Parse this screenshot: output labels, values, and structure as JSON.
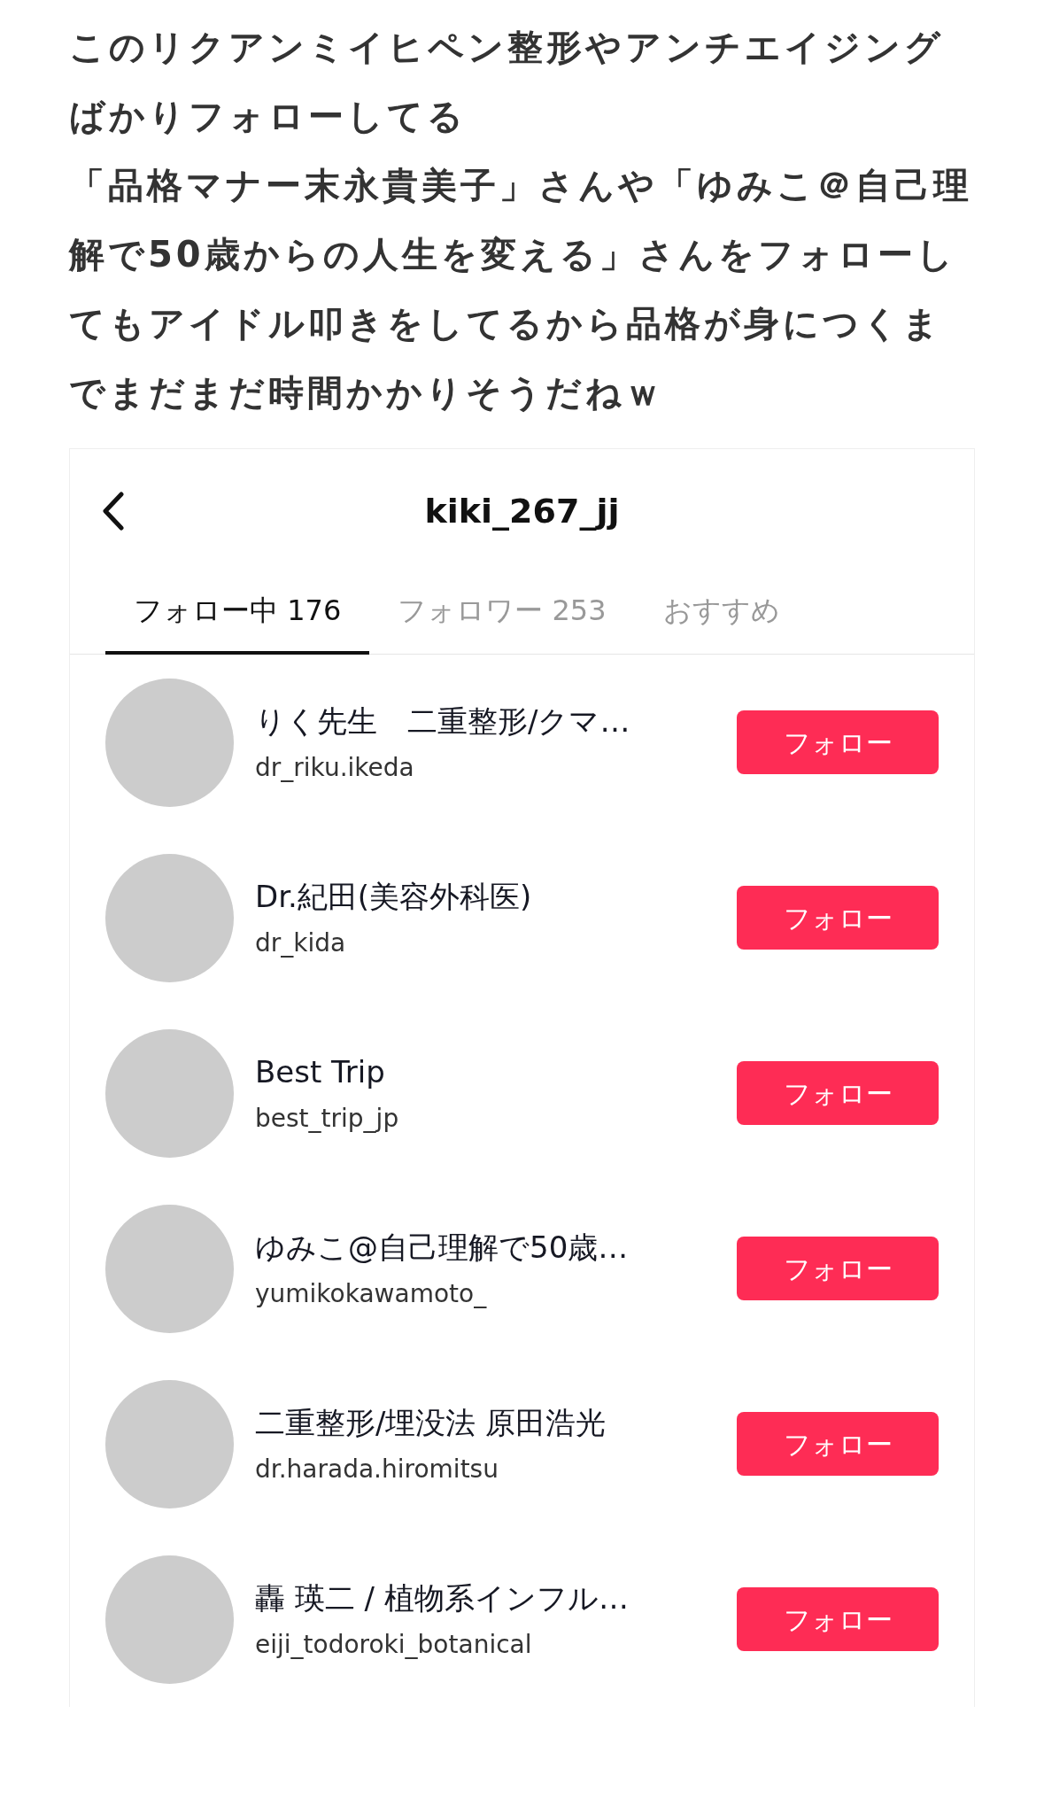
{
  "post_paragraphs": [
    "このリクアンミイヒペン整形やアンチエイジングばかりフォローしてる",
    "「品格マナー末永貴美子」さんや「ゆみこ＠自己理解で50歳からの人生を変える」さんをフォローしてもアイドル叩きをしてるから品格が身につくまでまだまだ時間かかりそうだねｗ"
  ],
  "screenshot": {
    "title": "kiki_267_jj",
    "tabs": [
      {
        "label": "フォロー中 176",
        "selected": true
      },
      {
        "label": "フォロワー 253",
        "selected": false
      },
      {
        "label": "おすすめ",
        "selected": false
      }
    ],
    "users": [
      {
        "name": "りく先生　二重整形/クマ…",
        "username": "dr_riku.ikeda",
        "button": "フォロー"
      },
      {
        "name": "Dr.紀田(美容外科医)",
        "username": "dr_kida",
        "button": "フォロー"
      },
      {
        "name": "Best Trip",
        "username": "best_trip_jp",
        "button": "フォロー"
      },
      {
        "name": "ゆみこ@自己理解で50歳…",
        "username": "yumikokawamoto_",
        "button": "フォロー"
      },
      {
        "name": "二重整形/埋没法  原田浩光",
        "username": "dr.harada.hiromitsu",
        "button": "フォロー"
      },
      {
        "name": "轟 瑛二 / 植物系インフル…",
        "username": "eiji_todoroki_botanical",
        "button": "フォロー"
      }
    ]
  }
}
